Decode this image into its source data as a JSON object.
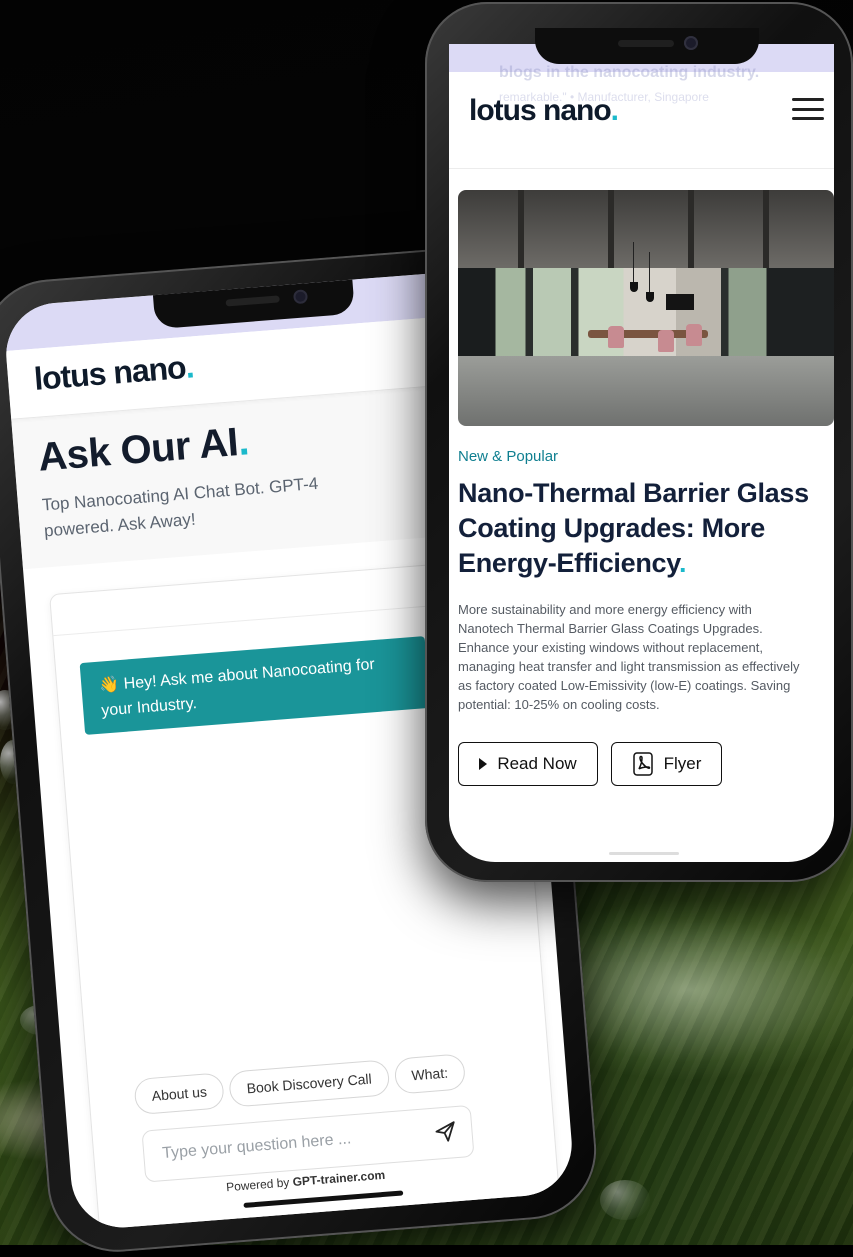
{
  "brand": {
    "name": "lotus nano",
    "dot": ".",
    "accent": "#1bb9cb",
    "teal": "#1a9599"
  },
  "left_phone": {
    "hero": {
      "title": "Ask Our AI",
      "subtitle": "Top Nanocoating AI Chat Bot. GPT-4 powered. Ask Away!"
    },
    "chat": {
      "bot_message_emoji": "👋",
      "bot_message": " Hey! Ask me about Nanocoating for your Industry.",
      "chips": [
        "About us",
        "Book Discovery Call",
        "What:"
      ],
      "input_placeholder": "Type your question here ...",
      "powered_by_prefix": "Powered by",
      "powered_by_name": "GPT-trainer.com"
    }
  },
  "right_phone": {
    "ghost_text": "blogs in the nanocoating industry.",
    "ghost_sub": "remarkable.\" • Manufacturer, Singapore",
    "article": {
      "tag": "New & Popular",
      "title": "Nano-Thermal Barrier Glass Coating Upgrades: More Energy-Efficiency",
      "body": "More sustainability and more energy efficiency with Nanotech Thermal Barrier Glass Coatings Upgrades. Enhance your existing windows without replacement, managing heat transfer and light transmission as effectively as factory coated Low-Emissivity (low-E) coatings. Saving potential: 10-25% on cooling costs.",
      "read_button": "Read Now",
      "flyer_button": "Flyer"
    }
  },
  "icons": [
    "hamburger-icon",
    "reload-icon",
    "send-icon",
    "play-icon",
    "pdf-icon"
  ]
}
